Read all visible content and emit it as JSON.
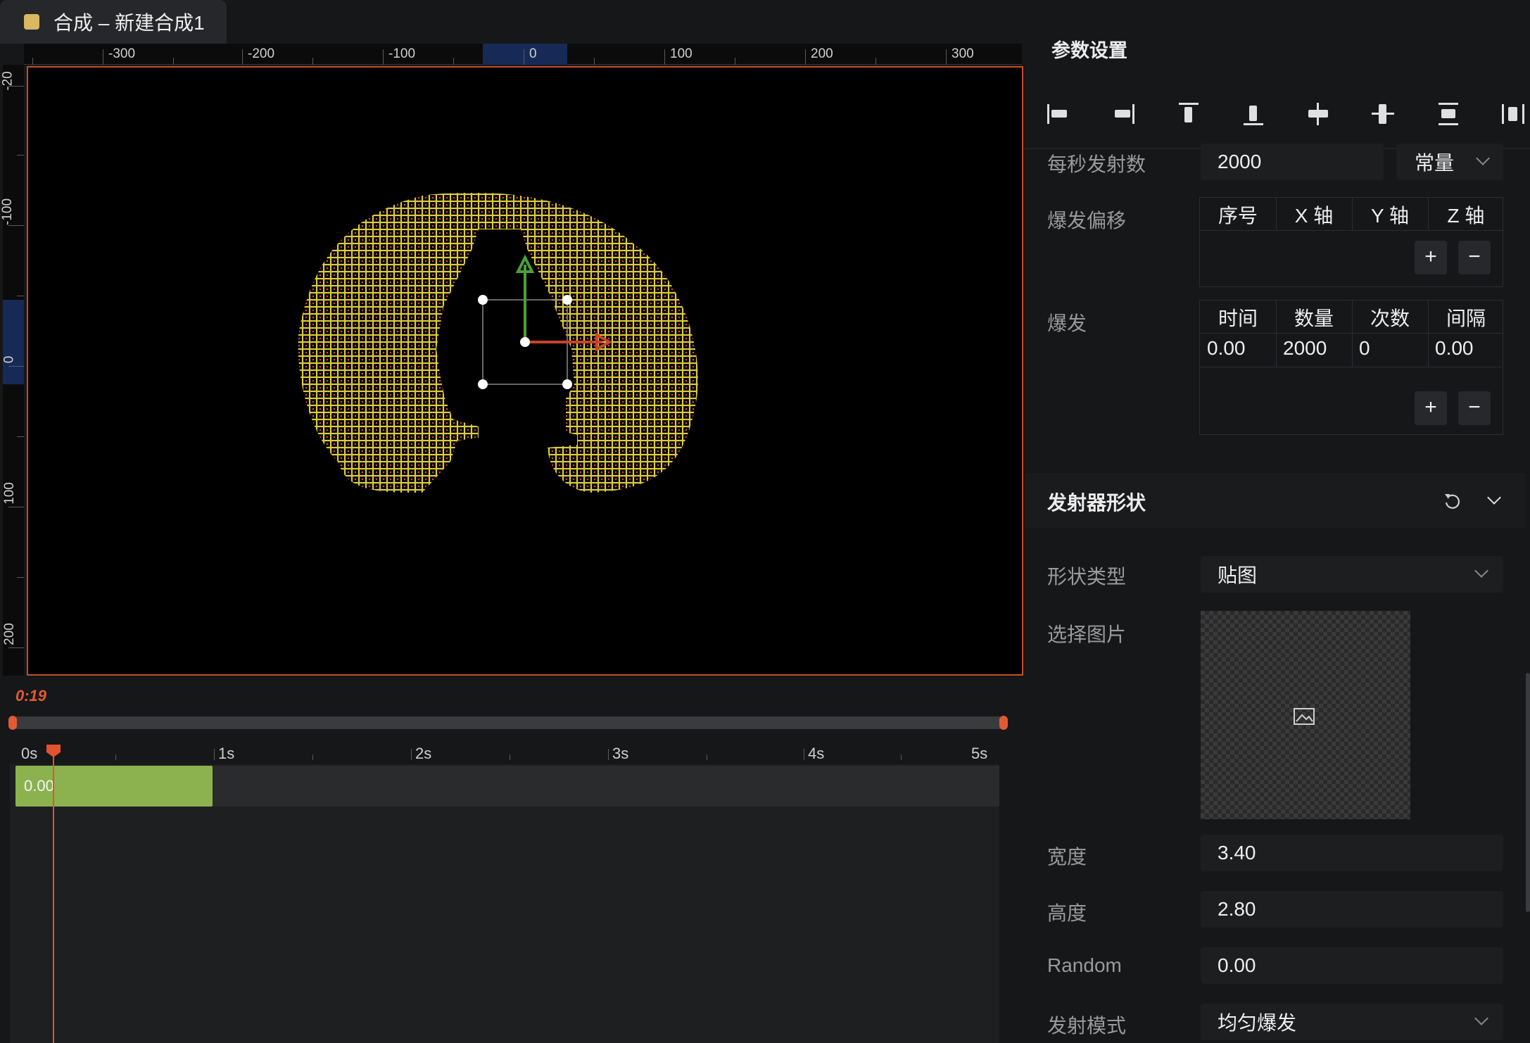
{
  "tab": {
    "title": "合成 – 新建合成1",
    "color": "#d8b860"
  },
  "ruler": {
    "h_labels": [
      "-300",
      "-200",
      "-100",
      "0",
      "100",
      "200",
      "300"
    ],
    "v_labels": [
      "-20",
      "-100",
      "0",
      "100",
      "200"
    ]
  },
  "timeline": {
    "timecode": "0:19",
    "marks": [
      "0s",
      "1s",
      "2s",
      "3s",
      "4s",
      "5s"
    ],
    "clip_label": "0.00"
  },
  "panel": {
    "title": "参数设置",
    "align_icons": [
      "align-left-icon",
      "align-right-icon",
      "align-top-icon",
      "align-bottom-icon",
      "align-center-vertical-icon",
      "align-center-horizontal-icon",
      "distribute-vertical-icon",
      "distribute-horizontal-icon"
    ],
    "emit_rate_label": "每秒发射数",
    "emit_rate_value": "2000",
    "emit_rate_mode": "常量",
    "burst_offset_label": "爆发偏移",
    "burst_offset_headers": [
      "序号",
      "X 轴",
      "Y 轴",
      "Z 轴"
    ],
    "burst_label": "爆发",
    "burst_headers": [
      "时间",
      "数量",
      "次数",
      "间隔"
    ],
    "burst_row": [
      "0.00",
      "2000",
      "0",
      "0.00"
    ],
    "add_label": "+",
    "remove_label": "−",
    "shape_section": "发射器形状",
    "shape_type_label": "形状类型",
    "shape_type_value": "贴图",
    "select_image_label": "选择图片",
    "width_label": "宽度",
    "width_value": "3.40",
    "height_label": "高度",
    "height_value": "2.80",
    "random_label": "Random",
    "random_value": "0.00",
    "emit_mode_label": "发射模式",
    "emit_mode_value": "均匀爆发"
  },
  "colors": {
    "accent": "#e2532f",
    "clip": "#8bb24f",
    "particle": "#d9cc3a"
  }
}
